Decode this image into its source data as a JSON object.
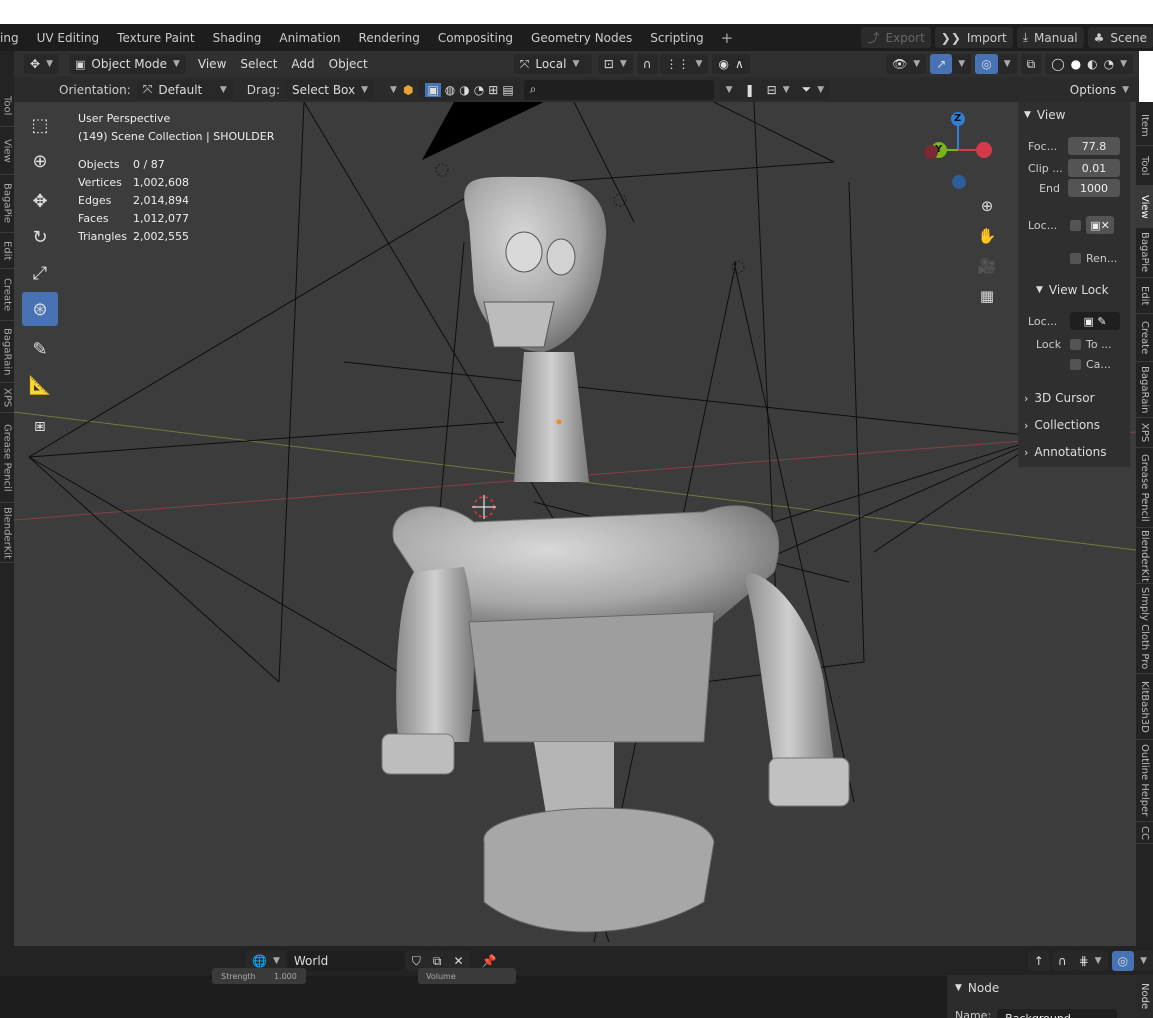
{
  "workspace_tabs": [
    "ing",
    "UV Editing",
    "Texture Paint",
    "Shading",
    "Animation",
    "Rendering",
    "Compositing",
    "Geometry Nodes",
    "Scripting"
  ],
  "workspace_add": "+",
  "topright": {
    "export": "Export",
    "import": "Import",
    "manual": "Manual",
    "scene": "Scene"
  },
  "header": {
    "mode": "Object Mode",
    "menus": {
      "view": "View",
      "select": "Select",
      "add": "Add",
      "object": "Object"
    },
    "transform": "Local"
  },
  "header2": {
    "orientation_label": "Orientation:",
    "orientation": "Default",
    "drag_label": "Drag:",
    "drag": "Select Box",
    "options": "Options"
  },
  "viewport": {
    "perspective": "User Perspective",
    "collection": "(149) Scene Collection | SHOULDER"
  },
  "stats": [
    {
      "label": "Objects",
      "value": "0 / 87"
    },
    {
      "label": "Vertices",
      "value": "1,002,608"
    },
    {
      "label": "Edges",
      "value": "2,014,894"
    },
    {
      "label": "Faces",
      "value": "1,012,077"
    },
    {
      "label": "Triangles",
      "value": "2,002,555"
    }
  ],
  "gizmo": {
    "z": "Z",
    "y": "Y"
  },
  "npanel": {
    "view_title": "View",
    "focal_label": "Foc...",
    "focal_value": "77.8",
    "clip_label": "Clip ...",
    "clip_value": "0.01",
    "end_label": "End",
    "end_value": "1000",
    "local_label": "Loc...",
    "render_label": "Ren...",
    "viewlock_title": "View Lock",
    "lock_obj_label": "Loc...",
    "lock_label": "Lock",
    "to_label": "To ...",
    "ca_label": "Ca...",
    "cursor_title": "3D Cursor",
    "collections_title": "Collections",
    "annotations_title": "Annotations"
  },
  "left_tabs": [
    "Tool",
    "View",
    "BagaPie",
    "Edit",
    "Create",
    "BagaRain",
    "XPS",
    "Grease Pencil",
    "BlenderKit"
  ],
  "right_tabs": [
    "Item",
    "Tool",
    "View",
    "BagaPie",
    "Edit",
    "Create",
    "BagaRain",
    "XPS",
    "Grease Pencil",
    "BlenderKit",
    "Simply Cloth Pro",
    "KitBash3D",
    "Outline Helper",
    "CC"
  ],
  "bottom": {
    "world": "World",
    "strength_label": "Strength",
    "strength_value": "1.000",
    "volume_label": "Volume",
    "node_title": "Node",
    "name_label": "Name:",
    "name_value": "Background",
    "node_tab": "Node"
  },
  "colors": {
    "accent": "#4772b3",
    "viewport_bg": "#3c3c3c",
    "header_bg": "#303030",
    "axis_x": "#d43a4a",
    "axis_y": "#7bb31d",
    "axis_z": "#2f7fd6"
  }
}
